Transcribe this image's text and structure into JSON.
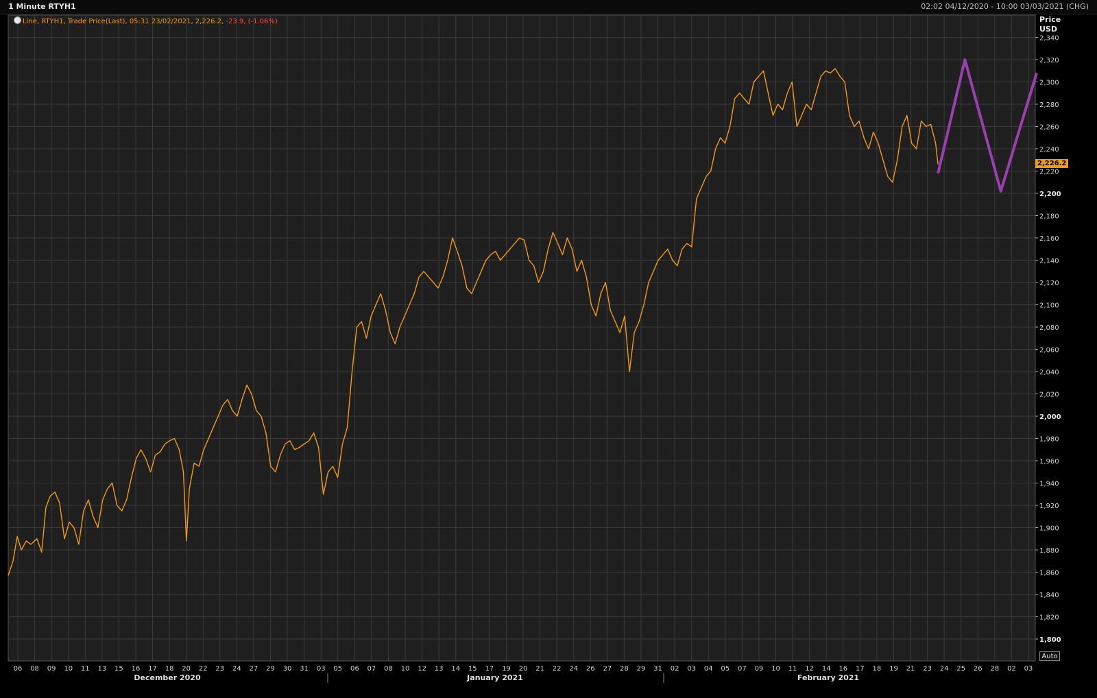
{
  "window": {
    "title": "1 Minute RTYH1",
    "range": "02:02 04/12/2020 - 10:00 03/03/2021 (CHG)"
  },
  "legend": {
    "prefix": "Line, RTYH1, Trade Price(Last), 05:31 23/02/2021, 2,226.2,",
    "change": "-23.9,",
    "pct": "(-1.06%)"
  },
  "axis": {
    "unit_line1": "Price",
    "unit_line2": "USD",
    "last_value_label": "2,226.2",
    "auto_label": "Auto"
  },
  "colors": {
    "background": "#1f1f1f",
    "grid": "#3a3a3a",
    "series": "#f39a1e",
    "projection": "#9b3fb0",
    "negative": "#ff4a4a"
  },
  "chart_data": {
    "type": "line",
    "title": "1 Minute RTYH1",
    "ylabel": "Price USD",
    "ylim": [
      1780,
      2350
    ],
    "y_ticks": [
      {
        "v": 1800,
        "label": "1,800",
        "major": true
      },
      {
        "v": 1820,
        "label": "1,820"
      },
      {
        "v": 1840,
        "label": "1,840"
      },
      {
        "v": 1860,
        "label": "1,860"
      },
      {
        "v": 1880,
        "label": "1,880"
      },
      {
        "v": 1900,
        "label": "1,900"
      },
      {
        "v": 1920,
        "label": "1,920"
      },
      {
        "v": 1940,
        "label": "1,940"
      },
      {
        "v": 1960,
        "label": "1,960"
      },
      {
        "v": 1980,
        "label": "1,980"
      },
      {
        "v": 2000,
        "label": "2,000",
        "major": true
      },
      {
        "v": 2020,
        "label": "2,020"
      },
      {
        "v": 2040,
        "label": "2,040"
      },
      {
        "v": 2060,
        "label": "2,060"
      },
      {
        "v": 2080,
        "label": "2,080"
      },
      {
        "v": 2100,
        "label": "2,100"
      },
      {
        "v": 2120,
        "label": "2,120"
      },
      {
        "v": 2140,
        "label": "2,140"
      },
      {
        "v": 2160,
        "label": "2,160"
      },
      {
        "v": 2180,
        "label": "2,180"
      },
      {
        "v": 2200,
        "label": "2,200",
        "major": true
      },
      {
        "v": 2220,
        "label": "2,220"
      },
      {
        "v": 2240,
        "label": "2,240"
      },
      {
        "v": 2260,
        "label": "2,260"
      },
      {
        "v": 2280,
        "label": "2,280"
      },
      {
        "v": 2300,
        "label": "2,300"
      },
      {
        "v": 2320,
        "label": "2,320"
      },
      {
        "v": 2340,
        "label": "2,340"
      }
    ],
    "x_ticks": [
      "06",
      "08",
      "09",
      "10",
      "11",
      "13",
      "15",
      "16",
      "17",
      "18",
      "20",
      "22",
      "23",
      "24",
      "27",
      "29",
      "30",
      "31",
      "03",
      "05",
      "06",
      "07",
      "08",
      "10",
      "12",
      "13",
      "14",
      "15",
      "17",
      "19",
      "20",
      "21",
      "22",
      "24",
      "26",
      "27",
      "28",
      "29",
      "31",
      "02",
      "03",
      "04",
      "05",
      "07",
      "09",
      "10",
      "11",
      "12",
      "14",
      "16",
      "17",
      "18",
      "19",
      "21",
      "23",
      "24",
      "25",
      "26",
      "28",
      "02",
      "03"
    ],
    "months": [
      "December 2020",
      "January 2021",
      "February 2021"
    ],
    "series": [
      {
        "values": [
          [
            0,
            1857
          ],
          [
            0.8,
            1870
          ],
          [
            1.5,
            1892
          ],
          [
            2.2,
            1880
          ],
          [
            3,
            1888
          ],
          [
            3.8,
            1885
          ],
          [
            4.8,
            1890
          ],
          [
            5.6,
            1878
          ],
          [
            6.3,
            1918
          ],
          [
            7,
            1928
          ],
          [
            7.8,
            1932
          ],
          [
            8.6,
            1922
          ],
          [
            9.4,
            1890
          ],
          [
            10.2,
            1905
          ],
          [
            11,
            1900
          ],
          [
            11.8,
            1885
          ],
          [
            12.6,
            1915
          ],
          [
            13.4,
            1925
          ],
          [
            14.2,
            1910
          ],
          [
            15,
            1900
          ],
          [
            15.8,
            1925
          ],
          [
            16.6,
            1935
          ],
          [
            17.4,
            1940
          ],
          [
            18.2,
            1920
          ],
          [
            19,
            1915
          ],
          [
            19.8,
            1925
          ],
          [
            20.6,
            1945
          ],
          [
            21.4,
            1962
          ],
          [
            22.2,
            1970
          ],
          [
            23,
            1962
          ],
          [
            23.8,
            1950
          ],
          [
            24.6,
            1965
          ],
          [
            25.4,
            1968
          ],
          [
            26.2,
            1975
          ],
          [
            27,
            1978
          ],
          [
            27.8,
            1980
          ],
          [
            28.6,
            1970
          ],
          [
            29.3,
            1950
          ],
          [
            29.8,
            1888
          ],
          [
            30.3,
            1935
          ],
          [
            31.1,
            1958
          ],
          [
            31.9,
            1955
          ],
          [
            32.7,
            1970
          ],
          [
            33.5,
            1980
          ],
          [
            34.3,
            1990
          ],
          [
            35.1,
            2000
          ],
          [
            35.9,
            2010
          ],
          [
            36.7,
            2015
          ],
          [
            37.5,
            2005
          ],
          [
            38.3,
            2000
          ],
          [
            39.1,
            2015
          ],
          [
            39.9,
            2028
          ],
          [
            40.7,
            2020
          ],
          [
            41.5,
            2005
          ],
          [
            42.3,
            2000
          ],
          [
            43.1,
            1985
          ],
          [
            43.9,
            1955
          ],
          [
            44.7,
            1950
          ],
          [
            45.5,
            1965
          ],
          [
            46.3,
            1975
          ],
          [
            47.1,
            1978
          ],
          [
            47.9,
            1970
          ],
          [
            48.7,
            1972
          ],
          [
            49.5,
            1975
          ],
          [
            50.3,
            1978
          ],
          [
            51.1,
            1985
          ],
          [
            51.9,
            1972
          ],
          [
            52.7,
            1930
          ],
          [
            53.5,
            1950
          ],
          [
            54.3,
            1955
          ],
          [
            55.1,
            1945
          ],
          [
            55.9,
            1975
          ],
          [
            56.7,
            1990
          ],
          [
            57.5,
            2040
          ],
          [
            58.3,
            2080
          ],
          [
            59.1,
            2085
          ],
          [
            59.9,
            2070
          ],
          [
            60.7,
            2090
          ],
          [
            61.5,
            2100
          ],
          [
            62.3,
            2110
          ],
          [
            63.1,
            2095
          ],
          [
            63.9,
            2075
          ],
          [
            64.7,
            2065
          ],
          [
            65.5,
            2080
          ],
          [
            66.3,
            2090
          ],
          [
            67.1,
            2100
          ],
          [
            67.9,
            2110
          ],
          [
            68.7,
            2125
          ],
          [
            69.5,
            2130
          ],
          [
            70.3,
            2125
          ],
          [
            71.1,
            2120
          ],
          [
            71.9,
            2115
          ],
          [
            72.7,
            2125
          ],
          [
            73.5,
            2140
          ],
          [
            74.3,
            2160
          ],
          [
            75.1,
            2148
          ],
          [
            75.9,
            2135
          ],
          [
            76.7,
            2115
          ],
          [
            77.5,
            2110
          ],
          [
            78.3,
            2120
          ],
          [
            79.1,
            2130
          ],
          [
            79.9,
            2140
          ],
          [
            80.7,
            2145
          ],
          [
            81.5,
            2148
          ],
          [
            82.3,
            2140
          ],
          [
            83.1,
            2145
          ],
          [
            83.9,
            2150
          ],
          [
            84.7,
            2155
          ],
          [
            85.5,
            2160
          ],
          [
            86.3,
            2158
          ],
          [
            87.1,
            2140
          ],
          [
            87.9,
            2135
          ],
          [
            88.7,
            2120
          ],
          [
            89.5,
            2130
          ],
          [
            90.3,
            2150
          ],
          [
            91.1,
            2165
          ],
          [
            91.9,
            2155
          ],
          [
            92.7,
            2145
          ],
          [
            93.5,
            2160
          ],
          [
            94.3,
            2150
          ],
          [
            95.1,
            2130
          ],
          [
            95.9,
            2140
          ],
          [
            96.7,
            2125
          ],
          [
            97.5,
            2100
          ],
          [
            98.3,
            2090
          ],
          [
            99.1,
            2110
          ],
          [
            99.9,
            2120
          ],
          [
            100.7,
            2095
          ],
          [
            101.5,
            2085
          ],
          [
            102.3,
            2075
          ],
          [
            103.1,
            2090
          ],
          [
            103.9,
            2040
          ],
          [
            104.7,
            2075
          ],
          [
            105.5,
            2085
          ],
          [
            106.3,
            2100
          ],
          [
            107.1,
            2120
          ],
          [
            107.9,
            2130
          ],
          [
            108.7,
            2140
          ],
          [
            109.5,
            2145
          ],
          [
            110.3,
            2150
          ],
          [
            111.1,
            2140
          ],
          [
            111.9,
            2135
          ],
          [
            112.7,
            2150
          ],
          [
            113.5,
            2155
          ],
          [
            114.3,
            2152
          ],
          [
            115.1,
            2195
          ],
          [
            115.9,
            2205
          ],
          [
            116.7,
            2215
          ],
          [
            117.5,
            2220
          ],
          [
            118.3,
            2240
          ],
          [
            119.1,
            2250
          ],
          [
            119.9,
            2245
          ],
          [
            120.7,
            2260
          ],
          [
            121.5,
            2285
          ],
          [
            122.3,
            2290
          ],
          [
            123.1,
            2285
          ],
          [
            123.9,
            2280
          ],
          [
            124.7,
            2300
          ],
          [
            125.5,
            2305
          ],
          [
            126.3,
            2310
          ],
          [
            127.1,
            2290
          ],
          [
            127.9,
            2270
          ],
          [
            128.7,
            2280
          ],
          [
            129.5,
            2275
          ],
          [
            130.3,
            2290
          ],
          [
            131.1,
            2300
          ],
          [
            131.9,
            2260
          ],
          [
            132.7,
            2270
          ],
          [
            133.5,
            2280
          ],
          [
            134.3,
            2275
          ],
          [
            135.1,
            2290
          ],
          [
            135.9,
            2305
          ],
          [
            136.7,
            2310
          ],
          [
            137.5,
            2308
          ],
          [
            138.3,
            2312
          ],
          [
            139.1,
            2305
          ],
          [
            139.9,
            2300
          ],
          [
            140.7,
            2270
          ],
          [
            141.5,
            2260
          ],
          [
            142.3,
            2265
          ],
          [
            143.1,
            2250
          ],
          [
            143.9,
            2240
          ],
          [
            144.7,
            2255
          ],
          [
            145.5,
            2245
          ],
          [
            146.3,
            2230
          ],
          [
            147.1,
            2215
          ],
          [
            147.9,
            2210
          ],
          [
            148.7,
            2230
          ],
          [
            149.5,
            2260
          ],
          [
            150.3,
            2270
          ],
          [
            151.1,
            2245
          ],
          [
            151.9,
            2240
          ],
          [
            152.7,
            2265
          ],
          [
            153.5,
            2260
          ],
          [
            154.3,
            2262
          ],
          [
            155.1,
            2245
          ],
          [
            155.5,
            2226
          ]
        ]
      },
      {
        "name": "projection",
        "values": [
          [
            155.5,
            2218
          ],
          [
            160,
            2320
          ],
          [
            166,
            2202
          ],
          [
            172,
            2308
          ]
        ]
      }
    ]
  }
}
